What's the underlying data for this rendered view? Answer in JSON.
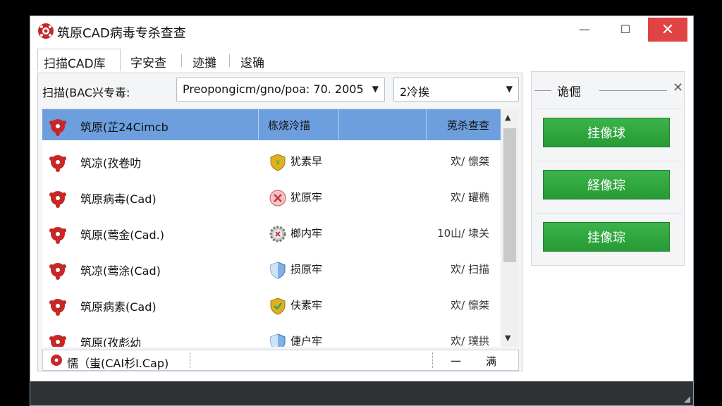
{
  "window": {
    "title": "筑原CAD病毒专杀查查",
    "min_label": "—",
    "max_label": "☐",
    "close_label": "✕"
  },
  "tabs": [
    {
      "label": "扫描CAD库",
      "active": true
    },
    {
      "label": "字安查"
    },
    {
      "label": "迹攤"
    },
    {
      "label": "逡确"
    }
  ],
  "filter": {
    "label": "扫描(BAC兴专毒:",
    "path_value": "Preopongicm/gno/poa: 70. 2005",
    "time_value": "2冷挨"
  },
  "list": {
    "header": {
      "name": "筑原(芷24Cimcb",
      "status": "栋烧泠描",
      "result": "莵杀查查"
    },
    "rows": [
      {
        "name": "筑凉(孜卷叻",
        "status": "犹素早",
        "result": "欢/ 懔桀",
        "icon": "shield-gold-icon"
      },
      {
        "name": "筑原病毒(Cad)",
        "status": "犹原牢",
        "result": "欢/ 罐椭",
        "icon": "shield-red-x-icon"
      },
      {
        "name": "筑原(莺金(Cad.)",
        "status": "榔内牢",
        "result": "10山/ 埭关",
        "icon": "gear-x-icon"
      },
      {
        "name": "筑凉(莺涂(Cad)",
        "status": "损原牢",
        "result": "欢/ 扫描",
        "icon": "shield-blue-icon"
      },
      {
        "name": "筑原病素(Cad)",
        "status": "伕素牢",
        "result": "欢/ 懔桀",
        "icon": "shield-gold-check-icon"
      },
      {
        "name": "筑原(孜彪幼",
        "status": "倢户牢",
        "result": "欢/ 璞拱",
        "icon": "shield-blue-icon"
      }
    ]
  },
  "statusbar": {
    "text": "懦（蚩(CAI杉I.Cap)",
    "mid": "一",
    "right": "满"
  },
  "side": {
    "title": "诡倔",
    "close_label": "✕",
    "buttons": [
      "挂像球",
      "経像琮",
      "挂像琮"
    ]
  },
  "colors": {
    "header_row": "#6d9fde",
    "scan_button": "#2fa83e",
    "close_button": "#e04343"
  }
}
